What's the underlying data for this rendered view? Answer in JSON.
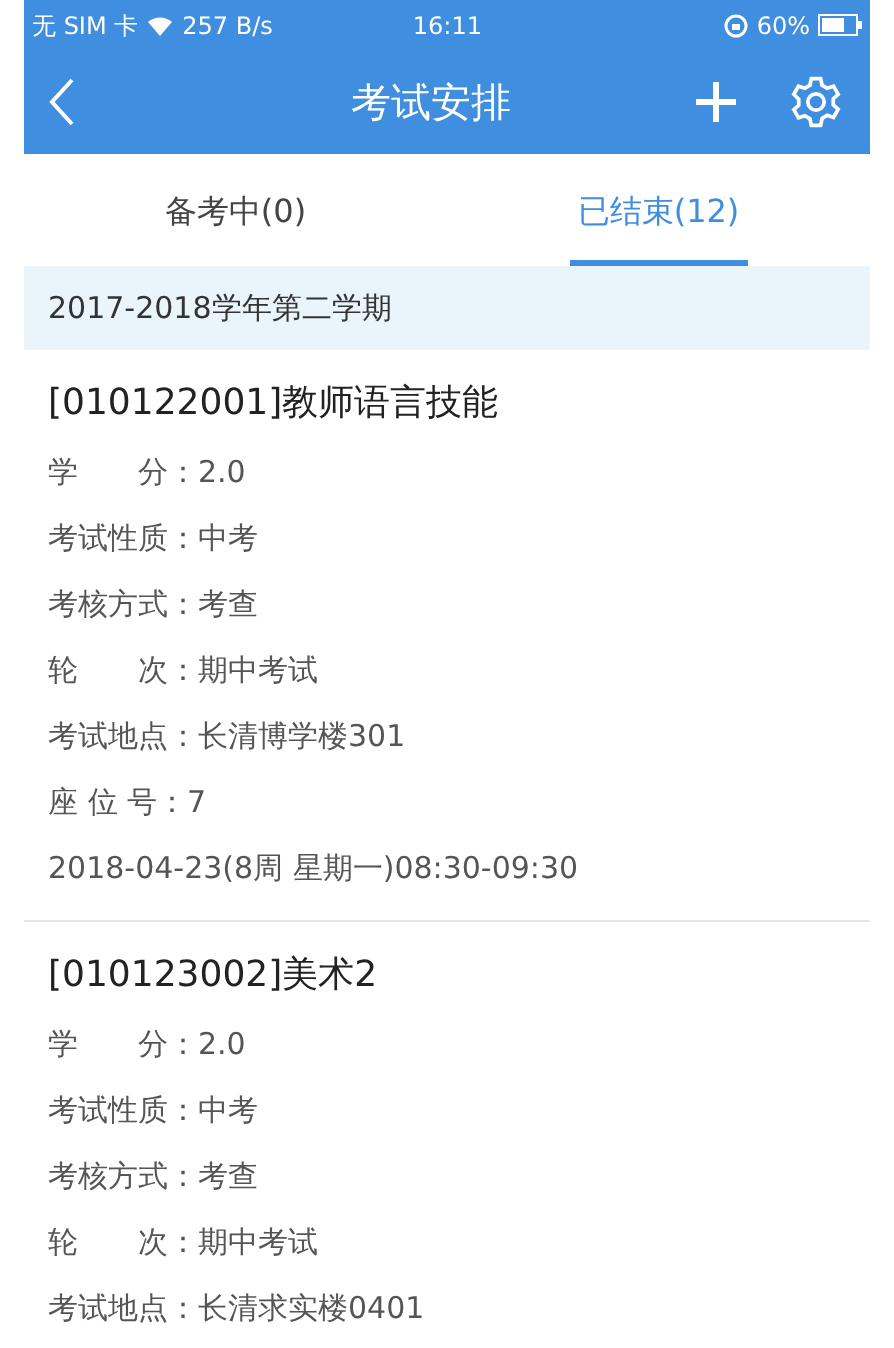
{
  "status_bar": {
    "carrier": "无 SIM 卡",
    "speed": "257 B/s",
    "time": "16:11",
    "battery": "60%"
  },
  "nav": {
    "title": "考试安排"
  },
  "tabs": [
    {
      "label": "备考中(0)",
      "selected": false
    },
    {
      "label": "已结束(12)",
      "selected": true
    }
  ],
  "semester": "2017-2018学年第二学期",
  "exams": [
    {
      "title": "[010122001]教师语言技能",
      "lines": [
        "学　　分：2.0",
        "考试性质：中考",
        "考核方式：考查",
        "轮　　次：期中考试",
        "考试地点：长清博学楼301",
        "座 位 号：7",
        "2018-04-23(8周 星期一)08:30-09:30"
      ]
    },
    {
      "title": "[010123002]美术2",
      "lines": [
        "学　　分：2.0",
        "考试性质：中考",
        "考核方式：考查",
        "轮　　次：期中考试",
        "考试地点：长清求实楼0401"
      ]
    }
  ]
}
